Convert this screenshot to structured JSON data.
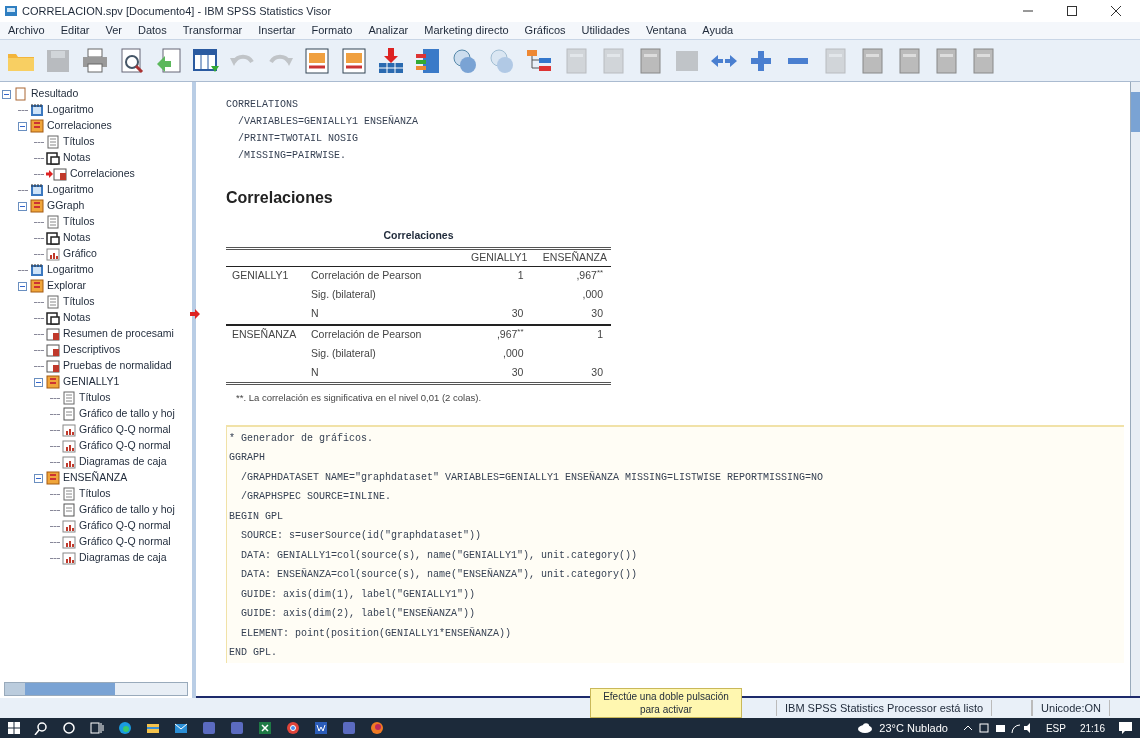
{
  "window": {
    "title": "CORRELACION.spv [Documento4] - IBM SPSS Statistics Visor"
  },
  "menu": [
    "Archivo",
    "Editar",
    "Ver",
    "Datos",
    "Transformar",
    "Insertar",
    "Formato",
    "Analizar",
    "Marketing directo",
    "Gráficos",
    "Utilidades",
    "Ventana",
    "Ayuda"
  ],
  "toolbar": [
    {
      "kind": "open"
    },
    {
      "kind": "save",
      "disabled": true
    },
    {
      "kind": "print"
    },
    {
      "kind": "preview"
    },
    {
      "kind": "export"
    },
    {
      "kind": "data"
    },
    {
      "kind": "undo",
      "disabled": true
    },
    {
      "kind": "redo",
      "disabled": true
    },
    {
      "kind": "goto"
    },
    {
      "kind": "goto"
    },
    {
      "kind": "insert"
    },
    {
      "kind": "variables"
    },
    {
      "kind": "circles"
    },
    {
      "kind": "circles",
      "disabled": true
    },
    {
      "kind": "tree"
    },
    {
      "kind": "page",
      "disabled": true
    },
    {
      "kind": "page",
      "disabled": true
    },
    {
      "kind": "page"
    },
    {
      "kind": "square",
      "disabled": true
    },
    {
      "kind": "arrows"
    },
    {
      "kind": "plus"
    },
    {
      "kind": "minus"
    },
    {
      "kind": "page",
      "disabled": true
    },
    {
      "kind": "page"
    },
    {
      "kind": "page"
    },
    {
      "kind": "page"
    },
    {
      "kind": "page"
    }
  ],
  "outline": [
    {
      "label": "Resultado",
      "kind": "root",
      "expanded": true,
      "children": [
        {
          "label": "Logaritmo",
          "kind": "log"
        },
        {
          "label": "Correlaciones",
          "kind": "folder",
          "expanded": true,
          "children": [
            {
              "label": "Títulos",
              "kind": "title"
            },
            {
              "label": "Notas",
              "kind": "notes"
            },
            {
              "label": "Correlaciones",
              "kind": "table",
              "current": true
            }
          ]
        },
        {
          "label": "Logaritmo",
          "kind": "log"
        },
        {
          "label": "GGraph",
          "kind": "folder",
          "expanded": true,
          "children": [
            {
              "label": "Títulos",
              "kind": "title"
            },
            {
              "label": "Notas",
              "kind": "notes"
            },
            {
              "label": "Gráfico",
              "kind": "chart"
            }
          ]
        },
        {
          "label": "Logaritmo",
          "kind": "log"
        },
        {
          "label": "Explorar",
          "kind": "folder",
          "expanded": true,
          "children": [
            {
              "label": "Títulos",
              "kind": "title"
            },
            {
              "label": "Notas",
              "kind": "notes"
            },
            {
              "label": "Resumen de procesami",
              "kind": "table"
            },
            {
              "label": "Descriptivos",
              "kind": "table"
            },
            {
              "label": "Pruebas de normalidad",
              "kind": "table"
            },
            {
              "label": "GENIALLY1",
              "kind": "folder",
              "expanded": true,
              "children": [
                {
                  "label": "Títulos",
                  "kind": "title"
                },
                {
                  "label": "Gráfico de tallo y hoj",
                  "kind": "page"
                },
                {
                  "label": "Gráfico Q-Q normal",
                  "kind": "chart"
                },
                {
                  "label": "Gráfico Q-Q normal",
                  "kind": "chart"
                },
                {
                  "label": "Diagramas de caja",
                  "kind": "chart"
                }
              ]
            },
            {
              "label": "ENSEÑANZA",
              "kind": "folder",
              "expanded": true,
              "children": [
                {
                  "label": "Títulos",
                  "kind": "title"
                },
                {
                  "label": "Gráfico de tallo y hoj",
                  "kind": "page"
                },
                {
                  "label": "Gráfico Q-Q normal",
                  "kind": "chart"
                },
                {
                  "label": "Gráfico Q-Q normal",
                  "kind": "chart"
                },
                {
                  "label": "Diagramas de caja",
                  "kind": "chart"
                }
              ]
            }
          ]
        }
      ]
    }
  ],
  "syntax": [
    "CORRELATIONS",
    "  /VARIABLES=GENIALLY1 ENSEÑANZA",
    "  /PRINT=TWOTAIL NOSIG",
    "  /MISSING=PAIRWISE."
  ],
  "heading": "Correlaciones",
  "table": {
    "title": "Correlaciones",
    "columns": [
      "GENIALLY1",
      "ENSEÑANZA"
    ],
    "rows": [
      {
        "group": "GENIALLY1",
        "stat": "Correlación de Pearson",
        "genially1": "1",
        "ensenanza": ",967$^{**}$"
      },
      {
        "stat": "Sig. (bilateral)",
        "ensenanza": ",000"
      },
      {
        "stat": "N",
        "genially1": "30",
        "ensenanza": "30",
        "current": true
      },
      {
        "group": "ENSEÑANZA",
        "stat": "Correlación de Pearson",
        "genially1": ",967$^{**}$",
        "ensenanza": "1"
      },
      {
        "stat": "Sig. (bilateral)",
        "genially1": ",000"
      },
      {
        "stat": "N",
        "genially1": "30",
        "ensenanza": "30"
      }
    ],
    "footnote": "**. La correlación es significativa en el nivel 0,01 (2 colas)."
  },
  "graph_syntax": [
    "* Generador de gráficos.",
    "GGRAPH",
    "  /GRAPHDATASET NAME=\"graphdataset\" VARIABLES=GENIALLY1 ENSEÑANZA MISSING=LISTWISE REPORTMISSING=NO",
    "  /GRAPHSPEC SOURCE=INLINE.",
    "BEGIN GPL",
    "  SOURCE: s=userSource(id(\"graphdataset\"))",
    "  DATA: GENIALLY1=col(source(s), name(\"GENIALLY1\"), unit.category())",
    "  DATA: ENSEÑANZA=col(source(s), name(\"ENSEÑANZA\"), unit.category())",
    "  GUIDE: axis(dim(1), label(\"GENIALLY1\"))",
    "  GUIDE: axis(dim(2), label(\"ENSEÑANZA\"))",
    "  ELEMENT: point(position(GENIALLY1*ENSEÑANZA))",
    "END GPL."
  ],
  "tooltip": "Efectúe una doble pulsación para activar",
  "status_bar": {
    "message": "IBM SPSS Statistics Processor está listo",
    "encoding": "Unicode:ON"
  },
  "taskbar": {
    "apps": [
      {
        "kind": "search"
      },
      {
        "kind": "cortana"
      },
      {
        "kind": "taskview"
      },
      {
        "kind": "edge"
      },
      {
        "kind": "files"
      },
      {
        "kind": "mail"
      },
      {
        "kind": "app"
      },
      {
        "kind": "app"
      },
      {
        "kind": "excel"
      },
      {
        "kind": "chrome"
      },
      {
        "kind": "word"
      },
      {
        "kind": "app"
      },
      {
        "kind": "firefox"
      }
    ],
    "weather": "23°C Nublado",
    "language": "ESP",
    "time": "21:16"
  }
}
